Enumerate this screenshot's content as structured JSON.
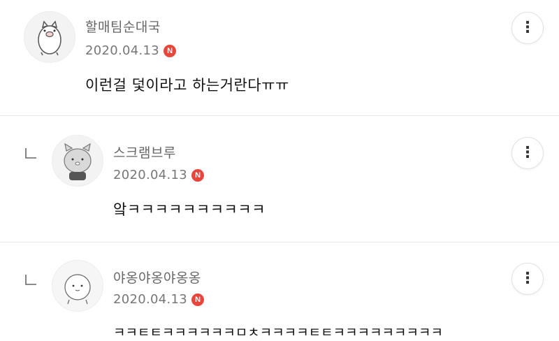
{
  "comments": [
    {
      "author": "할매팀순대국",
      "date": "2020.04.13",
      "badge": "N",
      "content": "이런걸 덫이라고 하는거란다ㅠㅠ",
      "avatar_icon": "pig-character-icon",
      "menu_icon": "⋮"
    },
    {
      "author": "스크램브루",
      "date": "2020.04.13",
      "badge": "N",
      "content": "앜ㅋㅋㅋㅋㅋㅋㅋㅋㅋㅋ",
      "avatar_icon": "cat-character-icon",
      "menu_icon": "⋮",
      "is_reply": true
    },
    {
      "author": "야옹야옹야옹옹",
      "date": "2020.04.13",
      "badge": "N",
      "content": "ㅋㅋㅌㅌㅋㅋㅋㅋㅋㅋㅁㅊㅋㅋㅋㅋㅌㅌㅋㅋㅋㅋㅋㅋㅋㅋㅋ",
      "avatar_icon": "round-face-character-icon",
      "menu_icon": "⋮",
      "is_reply": true
    }
  ],
  "colors": {
    "badge": "#e8463b",
    "divider": "#e8e8e8"
  }
}
